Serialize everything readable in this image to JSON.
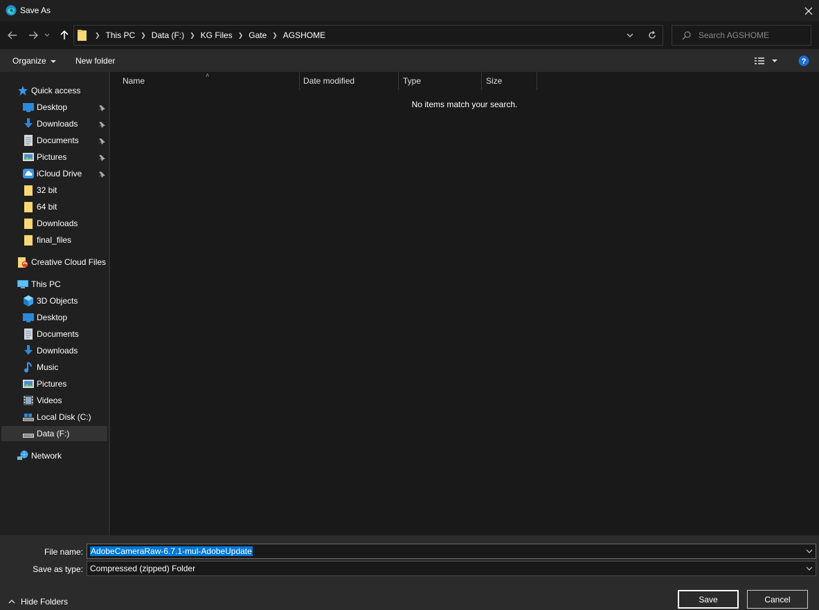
{
  "window": {
    "title": "Save As"
  },
  "address": {
    "crumbs": [
      "This PC",
      "Data (F:)",
      "KG Files",
      "Gate",
      "AGSHOME"
    ]
  },
  "search": {
    "placeholder": "Search AGSHOME"
  },
  "toolbar": {
    "organize_label": "Organize",
    "new_folder_label": "New folder"
  },
  "nav": {
    "quick_access": "Quick access",
    "quick_items": [
      {
        "label": "Desktop",
        "icon": "desktop-icon",
        "pinned": true
      },
      {
        "label": "Downloads",
        "icon": "downloads-icon",
        "pinned": true
      },
      {
        "label": "Documents",
        "icon": "documents-icon",
        "pinned": true
      },
      {
        "label": "Pictures",
        "icon": "pictures-icon",
        "pinned": true
      },
      {
        "label": "iCloud Drive",
        "icon": "icloud-icon",
        "pinned": true
      },
      {
        "label": "32 bit",
        "icon": "folder-icon",
        "pinned": false
      },
      {
        "label": "64 bit",
        "icon": "folder-icon",
        "pinned": false
      },
      {
        "label": "Downloads",
        "icon": "folder-icon",
        "pinned": false
      },
      {
        "label": "final_files",
        "icon": "folder-icon",
        "pinned": false
      }
    ],
    "creative_cloud": "Creative Cloud Files",
    "this_pc": "This PC",
    "pc_items": [
      {
        "label": "3D Objects",
        "icon": "3d-objects-icon"
      },
      {
        "label": "Desktop",
        "icon": "desktop-icon"
      },
      {
        "label": "Documents",
        "icon": "documents-icon"
      },
      {
        "label": "Downloads",
        "icon": "downloads-icon"
      },
      {
        "label": "Music",
        "icon": "music-icon"
      },
      {
        "label": "Pictures",
        "icon": "pictures-icon"
      },
      {
        "label": "Videos",
        "icon": "videos-icon"
      },
      {
        "label": "Local Disk (C:)",
        "icon": "local-disk-icon"
      },
      {
        "label": "Data (F:)",
        "icon": "drive-icon",
        "selected": true
      }
    ],
    "network": "Network"
  },
  "columns": {
    "name": "Name",
    "date": "Date modified",
    "type": "Type",
    "size": "Size"
  },
  "content": {
    "empty_message": "No items match your search."
  },
  "form": {
    "file_name_label": "File name:",
    "file_name_value": "AdobeCameraRaw-6.7.1-mul-AdobeUpdate",
    "save_type_label": "Save as type:",
    "save_type_value": "Compressed (zipped) Folder"
  },
  "footer": {
    "hide_folders": "Hide Folders",
    "save_label": "Save",
    "cancel_label": "Cancel"
  },
  "colors": {
    "accent": "#0078d7",
    "folder": "#f8d775",
    "background": "#202020"
  }
}
